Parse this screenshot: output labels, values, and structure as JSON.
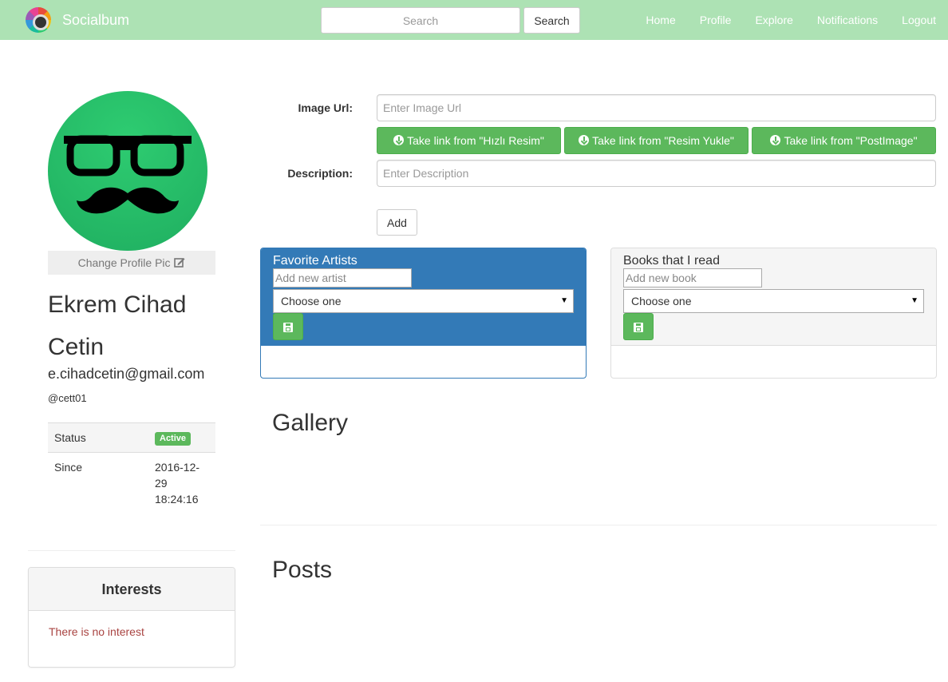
{
  "navbar": {
    "brand": "Socialbum",
    "search_placeholder": "Search",
    "search_button": "Search",
    "links": [
      "Home",
      "Profile",
      "Explore",
      "Notifications",
      "Logout"
    ]
  },
  "profile": {
    "change_pic_label": "Change Profile Pic",
    "name": "Ekrem Cihad Cetin",
    "email": "e.cihadcetin@gmail.com",
    "username": "@cett01",
    "status_label": "Status",
    "status_value": "Active",
    "since_label": "Since",
    "since_value": "2016-12-29 18:24:16"
  },
  "interests": {
    "title": "Interests",
    "empty_text": "There is no interest"
  },
  "form": {
    "image_url_label": "Image Url:",
    "image_url_placeholder": "Enter Image Url",
    "link_buttons": [
      "Take link from \"Hızlı Resim\"",
      "Take link from \"Resim Yukle\"",
      "Take link from \"PostImage\""
    ],
    "description_label": "Description:",
    "description_placeholder": "Enter Description",
    "add_button": "Add"
  },
  "artists_panel": {
    "title": "Favorite Artists",
    "input_placeholder": "Add new artist",
    "select_value": "Choose one"
  },
  "books_panel": {
    "title": "Books that I read",
    "input_placeholder": "Add new book",
    "select_value": "Choose one"
  },
  "sections": {
    "gallery": "Gallery",
    "posts": "Posts"
  },
  "colors": {
    "navbar_bg": "#ade2b4",
    "success_green": "#5cb85c",
    "primary_blue": "#337ab7",
    "danger_text": "#a94442"
  }
}
